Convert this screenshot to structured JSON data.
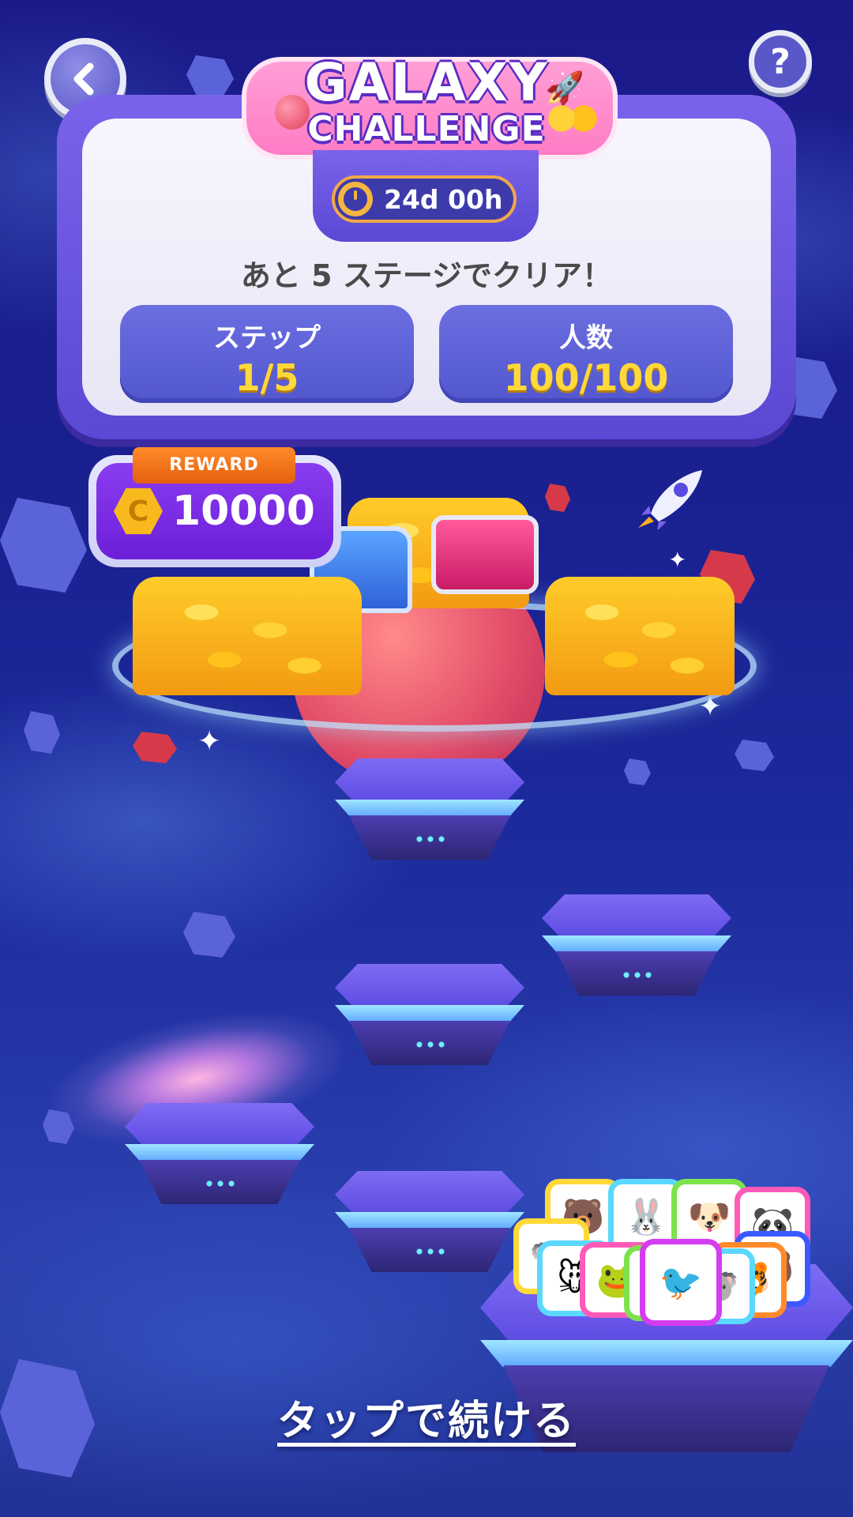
{
  "header": {
    "logo_line1": "GALAXY",
    "logo_line2": "CHALLENGE",
    "back_icon": "chevron-left-icon",
    "help_icon": "question-mark-icon",
    "help_label": "?"
  },
  "timer": {
    "value": "24d 00h",
    "icon": "clock-icon"
  },
  "progress_message": "あと 5 ステージでクリア！",
  "stats": [
    {
      "label": "ステップ",
      "value": "1/5"
    },
    {
      "label": "人数",
      "value": "100/100"
    }
  ],
  "reward": {
    "ribbon": "REWARD",
    "amount": "10000",
    "coin_symbol": "C"
  },
  "steps_total": 5,
  "current_step": 1,
  "continue_label": "タップで続ける",
  "colors": {
    "panel": "#6a56e0",
    "stat_value": "#ffd83a",
    "reward_purple": "#7a2ee6",
    "ribbon_orange": "#ff7a1e"
  }
}
